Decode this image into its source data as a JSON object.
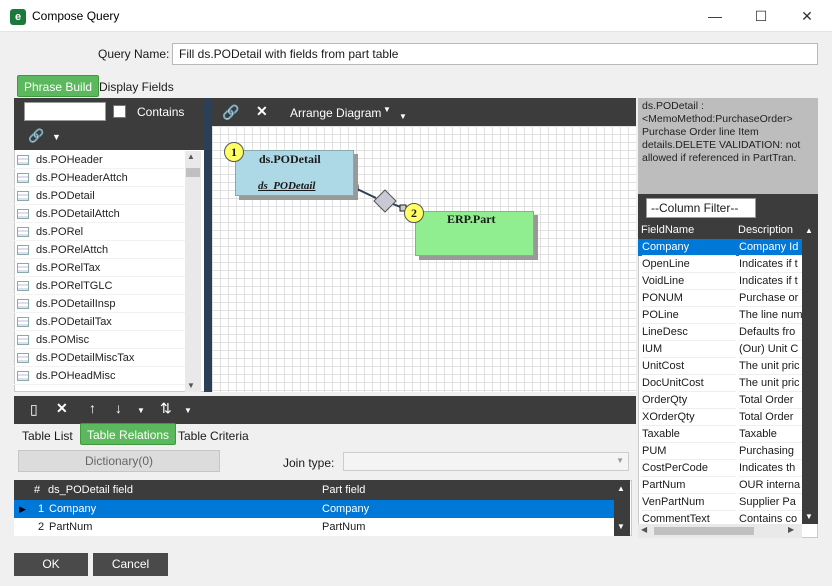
{
  "window": {
    "title": "Compose Query",
    "app_icon": "e",
    "controls": {
      "minimize": "—",
      "maximize": "☐",
      "close": "✕"
    }
  },
  "query": {
    "label": "Query Name:",
    "value": "Fill ds.PODetail with fields from part table"
  },
  "top_tabs": [
    {
      "label": "Phrase Build",
      "active": true
    },
    {
      "label": "Display Fields",
      "active": false
    }
  ],
  "table_list": {
    "contains_label": "Contains",
    "search_value": "",
    "items": [
      "ds.POHeader",
      "ds.POHeaderAttch",
      "ds.PODetail",
      "ds.PODetailAttch",
      "ds.PORel",
      "ds.PORelAttch",
      "ds.PORelTax",
      "ds.PORelTGLC",
      "ds.PODetailInsp",
      "ds.PODetailTax",
      "ds.POMisc",
      "ds.PODetailMiscTax",
      "ds.POHeadMisc"
    ]
  },
  "diagram": {
    "arrange_label": "Arrange Diagram",
    "nodes": [
      {
        "badge": "1",
        "title": "ds.PODetail",
        "subtitle": "ds_PODetail",
        "color": "#add8e6"
      },
      {
        "badge": "2",
        "title": "ERP.Part",
        "color": "#90ee90"
      }
    ]
  },
  "bottom_tabs": [
    {
      "label": "Table List",
      "active": false
    },
    {
      "label": "Table Relations",
      "active": true
    },
    {
      "label": "Table Criteria",
      "active": false
    }
  ],
  "relations": {
    "dictionary_label": "Dictionary(0)",
    "join_type_label": "Join type:",
    "join_type_value": "",
    "columns": [
      "#",
      "ds_PODetail field",
      "Part field"
    ],
    "rows": [
      {
        "num": "1",
        "left": "Company",
        "right": "Company",
        "selected": true
      },
      {
        "num": "2",
        "left": "PartNum",
        "right": "PartNum",
        "selected": false
      }
    ]
  },
  "description": "ds.PODetail : <MemoMethod:PurchaseOrder> Purchase Order line Item details.DELETE VALIDATION: not allowed if referenced in PartTran.",
  "field_panel": {
    "filter_value": "--Column Filter--",
    "columns": [
      "FieldName",
      "Description"
    ],
    "rows": [
      {
        "name": "Company",
        "desc": "Company Id",
        "selected": true
      },
      {
        "name": "OpenLine",
        "desc": "Indicates if t"
      },
      {
        "name": "VoidLine",
        "desc": "Indicates if t"
      },
      {
        "name": "PONUM",
        "desc": "Purchase or"
      },
      {
        "name": "POLine",
        "desc": "The line num"
      },
      {
        "name": "LineDesc",
        "desc": "Defaults fro"
      },
      {
        "name": "IUM",
        "desc": "(Our) Unit C"
      },
      {
        "name": "UnitCost",
        "desc": "The unit pric"
      },
      {
        "name": "DocUnitCost",
        "desc": "The unit pric"
      },
      {
        "name": "OrderQty",
        "desc": "Total Order"
      },
      {
        "name": "XOrderQty",
        "desc": "Total Order"
      },
      {
        "name": "Taxable",
        "desc": "Taxable"
      },
      {
        "name": "PUM",
        "desc": "Purchasing"
      },
      {
        "name": "CostPerCode",
        "desc": "Indicates th"
      },
      {
        "name": "PartNum",
        "desc": "OUR interna"
      },
      {
        "name": "VenPartNum",
        "desc": "Supplier Pa"
      },
      {
        "name": "CommentText",
        "desc": "Contains co"
      }
    ]
  },
  "footer": {
    "ok_label": "OK",
    "cancel_label": "Cancel"
  },
  "colors": {
    "accent_green": "#5cb85c",
    "selection_blue": "#0078d7",
    "dark_bar": "#3c3c3c"
  }
}
